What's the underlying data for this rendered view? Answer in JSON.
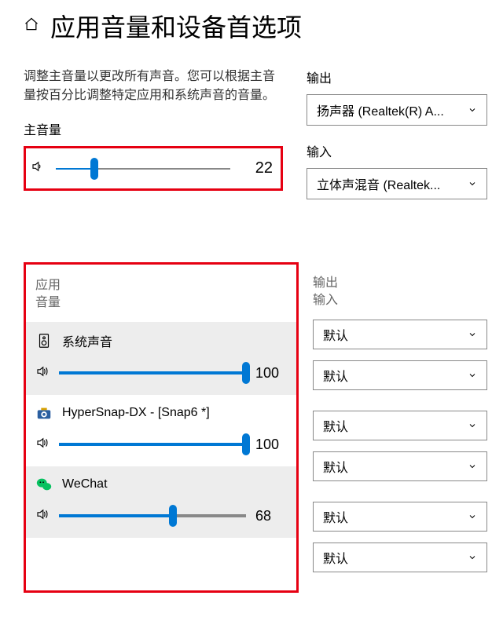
{
  "header": {
    "title": "应用音量和设备首选项"
  },
  "description": "调整主音量以更改所有声音。您可以根据主音量按百分比调整特定应用和系统声音的音量。",
  "mainVolume": {
    "label": "主音量",
    "value": "22",
    "percent": 22
  },
  "devices": {
    "outputLabel": "输出",
    "outputValue": "扬声器 (Realtek(R) A...",
    "inputLabel": "输入",
    "inputValue": "立体声混音 (Realtek..."
  },
  "columns": {
    "left1": "应用",
    "left2": "音量",
    "right1": "输出",
    "right2": "输入"
  },
  "apps": [
    {
      "name": "系统声音",
      "icon": "speaker-device-icon",
      "volume": "100",
      "percent": 100,
      "output": "默认",
      "input": "默认",
      "shaded": true
    },
    {
      "name": "HyperSnap-DX - [Snap6 *]",
      "icon": "camera-icon",
      "volume": "100",
      "percent": 100,
      "output": "默认",
      "input": "默认",
      "shaded": false
    },
    {
      "name": "WeChat",
      "icon": "wechat-icon",
      "volume": "68",
      "percent": 61,
      "output": "默认",
      "input": "默认",
      "shaded": true
    }
  ]
}
